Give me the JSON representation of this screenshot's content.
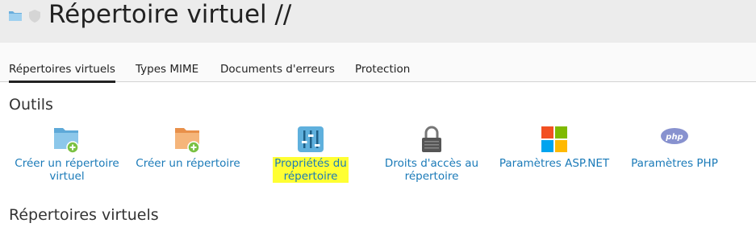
{
  "header": {
    "title": "Répertoire virtuel //"
  },
  "tabs": [
    {
      "label": "Répertoires virtuels",
      "active": true
    },
    {
      "label": "Types MIME",
      "active": false
    },
    {
      "label": "Documents d'erreurs",
      "active": false
    },
    {
      "label": "Protection",
      "active": false
    }
  ],
  "tools_section": {
    "title": "Outils",
    "items": [
      {
        "label_line1": "Créer un répertoire",
        "label_line2": "virtuel",
        "icon": "folder-add-icon"
      },
      {
        "label_line1": "Créer un répertoire",
        "label_line2": "",
        "icon": "folder-add-icon"
      },
      {
        "label_line1": "Propriétés du",
        "label_line2": "répertoire",
        "icon": "sliders-icon",
        "highlighted": true
      },
      {
        "label_line1": "Droits d'accès au",
        "label_line2": "répertoire",
        "icon": "lock-icon"
      },
      {
        "label_line1": "Paramètres ASP.NET",
        "label_line2": "",
        "icon": "windows-logo-icon"
      },
      {
        "label_line1": "Paramètres PHP",
        "label_line2": "",
        "icon": "php-logo-icon"
      }
    ]
  },
  "virtual_dirs_section": {
    "title": "Répertoires virtuels"
  },
  "colors": {
    "link": "#1a7ab8",
    "highlight": "#ffff33",
    "titlebar_bg": "#ececec"
  }
}
